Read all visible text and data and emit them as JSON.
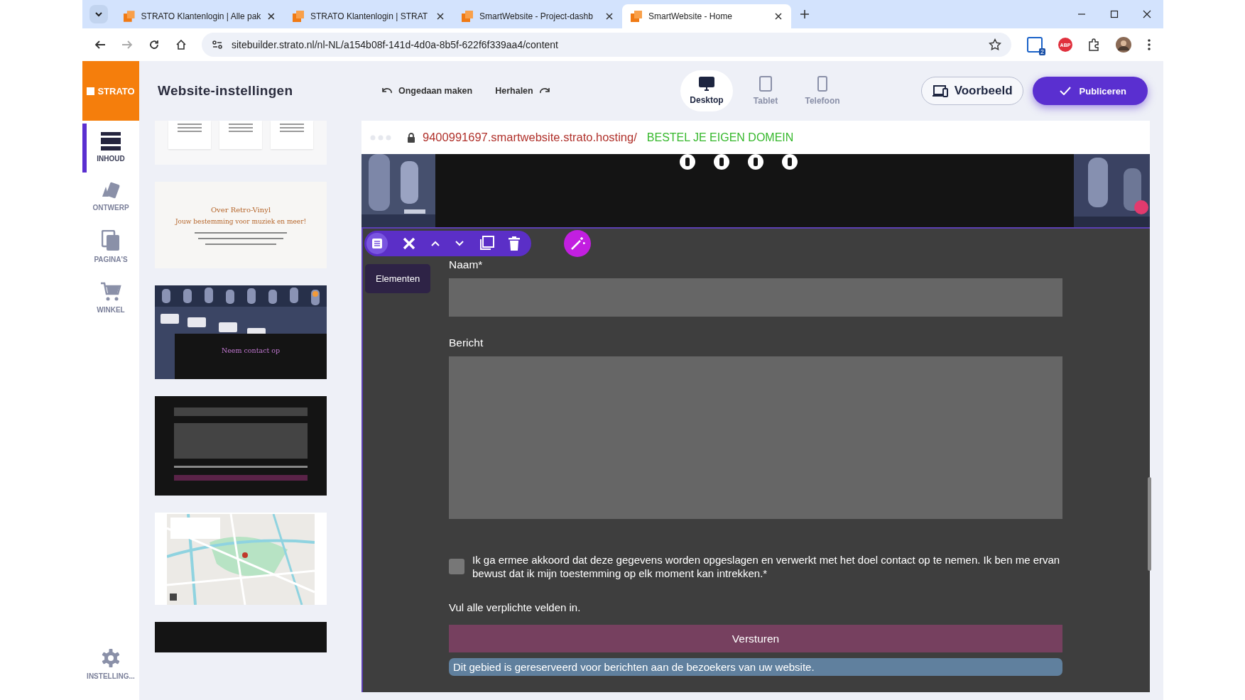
{
  "browser": {
    "tabs": [
      {
        "title": "STRATO Klantenlogin | Alle pak",
        "selected": false
      },
      {
        "title": "STRATO Klantenlogin | STRAT",
        "selected": false
      },
      {
        "title": "SmartWebsite - Project-dashb",
        "selected": false
      },
      {
        "title": "SmartWebsite - Home",
        "selected": true
      }
    ],
    "address": "sitebuilder.strato.nl/nl-NL/a154b08f-141d-4d0a-8b5f-622f6f339aa4/content",
    "extension_badge": "2",
    "adblock_badge": "ABP"
  },
  "header": {
    "logo": "STRATO",
    "title": "Website-instellingen",
    "undo": "Ongedaan maken",
    "redo": "Herhalen",
    "devices": [
      {
        "label": "Desktop",
        "kind": "desktop",
        "selected": true
      },
      {
        "label": "Tablet",
        "kind": "tablet",
        "selected": false
      },
      {
        "label": "Telefoon",
        "kind": "phone",
        "selected": false
      }
    ],
    "preview_button": "Voorbeeld",
    "publish_button": "Publiceren"
  },
  "rail": [
    {
      "label": "INHOUD",
      "kind": "content",
      "selected": true
    },
    {
      "label": "ONTWERP",
      "kind": "design",
      "selected": false
    },
    {
      "label": "PAGINA'S",
      "kind": "pages",
      "selected": false
    },
    {
      "label": "WINKEL",
      "kind": "shop",
      "selected": false
    }
  ],
  "settings": "INSTELLING...",
  "thumbnails": [
    {
      "kind": "cards"
    },
    {
      "kind": "about",
      "title": "Over Retro-Vinyl",
      "subtitle": "Jouw bestemming voor muziek en meer!"
    },
    {
      "kind": "contact",
      "title": "Neem contact op"
    },
    {
      "kind": "form"
    },
    {
      "kind": "map"
    },
    {
      "kind": "footer"
    }
  ],
  "preview": {
    "url": "9400991697.smartwebsite.strato.hosting/",
    "domain_link": "BESTEL JE EIGEN DOMEIN",
    "tooltip": "Elementen",
    "form": {
      "name_label": "Naam*",
      "message_label": "Bericht",
      "consent": "Ik ga ermee akkoord dat deze gegevens worden opgeslagen en verwerkt met het doel contact op te nemen. Ik ben me ervan bewust dat ik mijn toestemming op elk moment kan intrekken.*",
      "consent_checked": false,
      "required_note": "Vul alle verplichte velden in.",
      "submit": "Versturen",
      "notice": "Dit gebied is gereserveerd voor berichten aan de bezoekers van uw website."
    }
  }
}
